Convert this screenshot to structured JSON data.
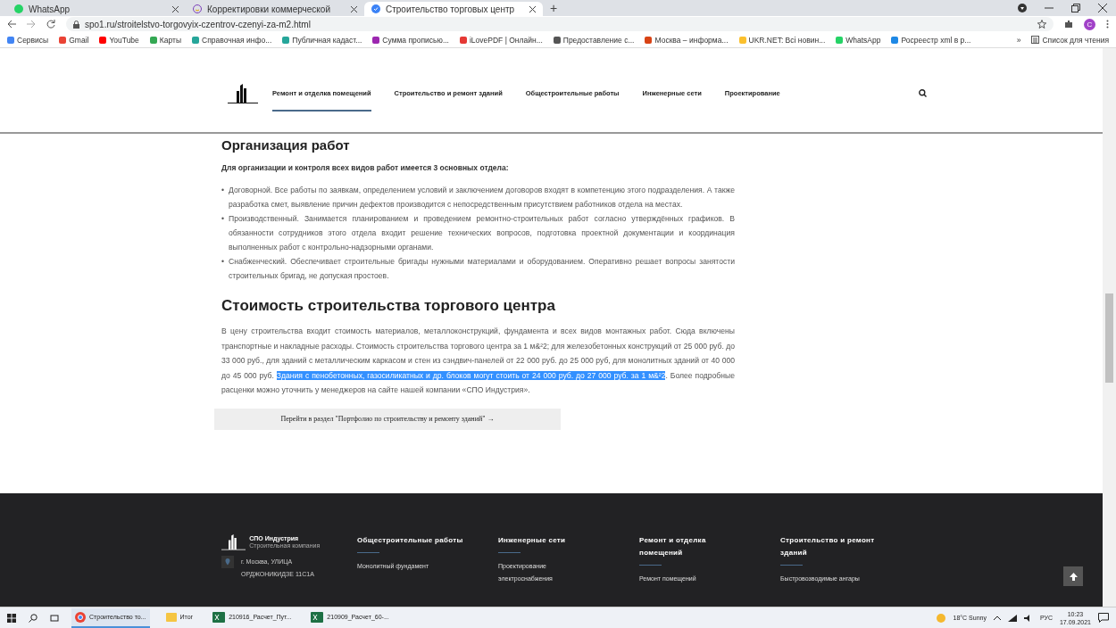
{
  "browser": {
    "tabs": [
      {
        "title": "WhatsApp",
        "kind": "whatsapp",
        "selected": false
      },
      {
        "title": "Корректировки коммерческой",
        "kind": "doc",
        "selected": false
      },
      {
        "title": "Строительство торговых центр",
        "kind": "check",
        "selected": true
      }
    ],
    "new_tab": "+",
    "url": "spo1.ru/stroitelstvo-torgovyix-czentrov-czenyi-za-m2.html",
    "profile": "C",
    "bookmarks": [
      {
        "label": "Сервисы",
        "color": "#4285f4"
      },
      {
        "label": "Gmail",
        "color": "#ea4335"
      },
      {
        "label": "YouTube",
        "color": "#ff0000"
      },
      {
        "label": "Карты",
        "color": "#34a853"
      },
      {
        "label": "Справочная инфо...",
        "color": "#26a69a"
      },
      {
        "label": "Публичная кадаст...",
        "color": "#26a69a"
      },
      {
        "label": "Сумма прописью...",
        "color": "#9c27b0"
      },
      {
        "label": "iLovePDF | Онлайн...",
        "color": "#e53935"
      },
      {
        "label": "Предоставление с...",
        "color": "#555555"
      },
      {
        "label": "Москва – информа...",
        "color": "#d84315"
      },
      {
        "label": "UKR.NET: Всі новин...",
        "color": "#fbc02d"
      },
      {
        "label": "WhatsApp",
        "color": "#25d366"
      },
      {
        "label": "Росреестр xml в р...",
        "color": "#1e88e5"
      }
    ],
    "more_bookmarks": "»",
    "reading_list": "Список для чтения"
  },
  "site": {
    "nav": [
      {
        "label": "Ремонт и отделка помещений",
        "selected": true
      },
      {
        "label": "Строительство и ремонт зданий",
        "selected": false
      },
      {
        "label": "Общестроительные работы",
        "selected": false
      },
      {
        "label": "Инженерные сети",
        "selected": false
      },
      {
        "label": "Проектирование",
        "selected": false
      }
    ],
    "section_heading": "Организация работ",
    "intro": "Для организации и контроля всех видов работ имеется 3 основных отдела:",
    "bullet": "•",
    "departments": [
      "Договорной. Все работы по заявкам, определением условий и заключением договоров входят в компетенцию этого подразделения. А также разработка смет, выявление причин дефектов производится с непосредственным присутствием работников отдела на местах.",
      "Производственный. Занимается планированием и проведением ремонтно-строительных работ согласно утверждённых графиков. В обязанности сотрудников этого отдела входит решение технических вопросов, подготовка проектной документации и координация выполненных работ с контрольно-надзорными органами.",
      "Снабженческий. Обеспечивает строительные бригады нужными материалами и оборудованием. Оперативно решает вопросы занятости строительных бригад, не допуская простоев."
    ],
    "cost_heading": "Стоимость строительства торгового центра",
    "cost_text": [
      {
        "text": "В цену строительства входит стоимость материалов, металлоконструкций, фундамента и всех видов монтажных работ. Сюда включены транспортные и накладные расходы. Стоимость строительства торгового центра за 1 м&²2; для железобетонных конструкций от 25 000 руб. до 33 000 руб., для зданий с металлическим каркасом и стен из сэндвич-панелей от 22 000 руб. до 25 000 руб, для монолитных зданий от 40 000 до 45 000 руб. ",
        "selected": false
      },
      {
        "text": "Здания с пенобетонных, газосиликатных и др. блоков могут стоить от 24 000 руб. до 27 000 руб. за 1 м&²2",
        "selected": true
      },
      {
        "text": ". Более подробные расценки можно уточнить у менеджеров на сайте нашей компании «СПО Индустрия».",
        "selected": false
      }
    ],
    "portfolio_link": "Перейти в раздел \"Портфолио по строительству и ремонту зданий\" →",
    "footer": {
      "brand": "СПО Индустрия",
      "tagline": "Строительная компания",
      "address": [
        "г. Москва, УЛИЦА",
        "ОРДЖОНИКИДЗЕ 11С1А"
      ],
      "columns": [
        {
          "title": "Общестроительные работы",
          "items": [
            "Монолитный фундамент"
          ]
        },
        {
          "title": "Инженерные сети",
          "items": [
            "Проектирование электроснабжения"
          ]
        },
        {
          "title": "Ремонт и отделка помещений",
          "items": [
            "Ремонт помещений"
          ]
        },
        {
          "title": "Строительство и ремонт зданий",
          "items": [
            "Быстровозводимые ангары"
          ]
        }
      ]
    }
  },
  "taskbar": {
    "apps": [
      {
        "label": "Строительство то...",
        "kind": "chrome",
        "selected": true
      },
      {
        "label": "Итог",
        "kind": "folder",
        "selected": false
      },
      {
        "label": "210916_Расчет_Пут...",
        "kind": "excel",
        "selected": false
      },
      {
        "label": "210909_Расчет_60-...",
        "kind": "excel",
        "selected": false
      }
    ],
    "weather": "18°C Sunny",
    "language": "РУС",
    "time": "10:23",
    "date": "17.09.2021"
  }
}
